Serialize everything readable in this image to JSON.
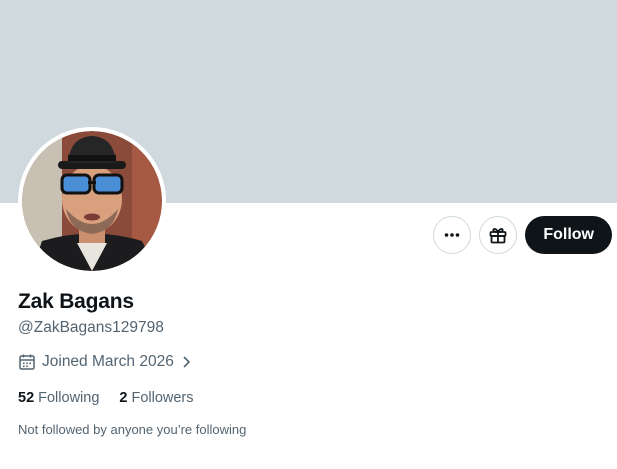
{
  "banner": {
    "color": "#cfd9de"
  },
  "profile": {
    "name": "Zak Bagans",
    "handle": "@ZakBagans129798",
    "joined": "Joined March 2026",
    "avatar_alt": "Zak Bagans profile photo"
  },
  "actions": {
    "more_icon": "more-horizontal-icon",
    "subscribe_icon": "gift-icon",
    "follow_label": "Follow"
  },
  "stats": {
    "following_count": "52",
    "following_label": "Following",
    "followers_count": "2",
    "followers_label": "Followers"
  },
  "note": "Not followed by anyone you’re following",
  "colors": {
    "text_primary": "#0f1419",
    "text_secondary": "#536471",
    "border": "#cfd9de",
    "follow_bg": "#0f1419"
  }
}
